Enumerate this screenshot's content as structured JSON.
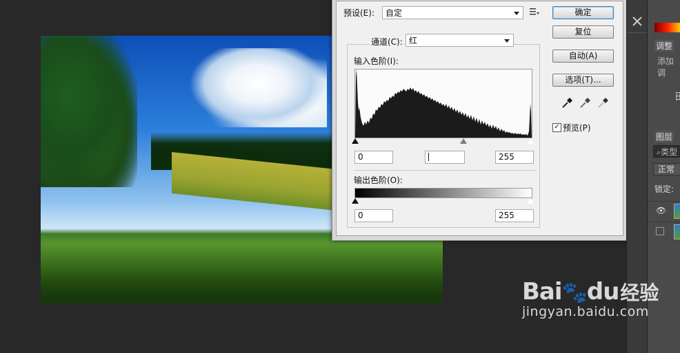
{
  "levels_dialog": {
    "preset_label": "预设(E):",
    "preset_value": "自定",
    "channel_label": "通道(C):",
    "channel_value": "红",
    "input_levels_label": "输入色阶(I):",
    "input_black": "0",
    "input_gray": "",
    "input_white": "255",
    "output_levels_label": "输出色阶(O):",
    "output_black": "0",
    "output_white": "255",
    "buttons": {
      "ok": "确定",
      "reset": "复位",
      "auto": "自动(A)",
      "options": "选项(T)..."
    },
    "preview_label": "预览(P)",
    "preview_checked": true
  },
  "panels": {
    "adjustments_tab": "调整",
    "add_adjustment": "添加调",
    "layers_tab": "图层",
    "search_placeholder": "类型",
    "blend_mode": "正常",
    "lock_label": "锁定:"
  },
  "watermark": {
    "brand": "Bai",
    "brand_tail": "du",
    "jingyan": "经验",
    "url": "jingyan.baidu.com"
  }
}
